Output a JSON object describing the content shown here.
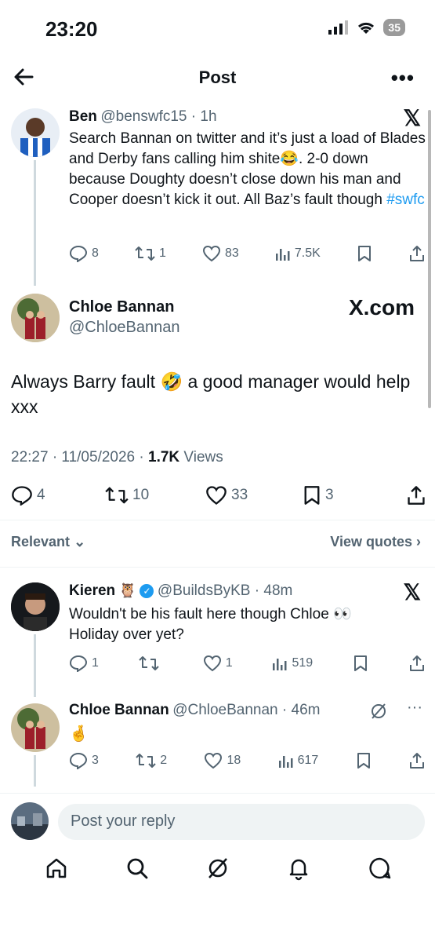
{
  "status_bar": {
    "time": "23:20",
    "battery": "35"
  },
  "header": {
    "title": "Post"
  },
  "tweet1": {
    "name": "Ben",
    "handle": "@benswfc15",
    "time": "1h",
    "text": "Search Bannan on twitter and it’s just a load of Blades and Derby fans calling him shite😂. 2-0 down because Doughty doesn’t close down his man and Cooper doesn’t kick it out. All Baz’s fault though ",
    "hashtag": "#swfc",
    "replies": "8",
    "reposts": "1",
    "likes": "83",
    "views": "7.5K"
  },
  "main_post": {
    "name": "Chloe Bannan",
    "handle": "@ChloeBannan",
    "brand": "X.com",
    "text": "Always Barry fault 🤣 a good manager would help xxx",
    "timestamp": "22:27 · 11/05/2026 · ",
    "views_count": "1.7K",
    "views_label": "Views",
    "replies": "4",
    "reposts": "10",
    "likes": "33",
    "bookmarks": "3"
  },
  "filters": {
    "sort": "Relevant",
    "view_quotes": "View quotes"
  },
  "reply1": {
    "name": "Kieren",
    "badge_emoji": "🦉",
    "handle": "@BuildsByKB",
    "time": "48m",
    "text": "Wouldn't be his fault here though Chloe 👀 Holiday over yet?",
    "replies": "1",
    "reposts": "",
    "likes": "1",
    "views": "519"
  },
  "reply2": {
    "name": "Chloe Bannan",
    "handle": "@ChloeBannan",
    "time": "46m",
    "text": "🤞",
    "replies": "3",
    "reposts": "2",
    "likes": "18",
    "views": "617"
  },
  "composer": {
    "placeholder": "Post your reply"
  },
  "colors": {
    "accent": "#1d9bf0",
    "text": "#0f1419",
    "muted": "#536471"
  }
}
